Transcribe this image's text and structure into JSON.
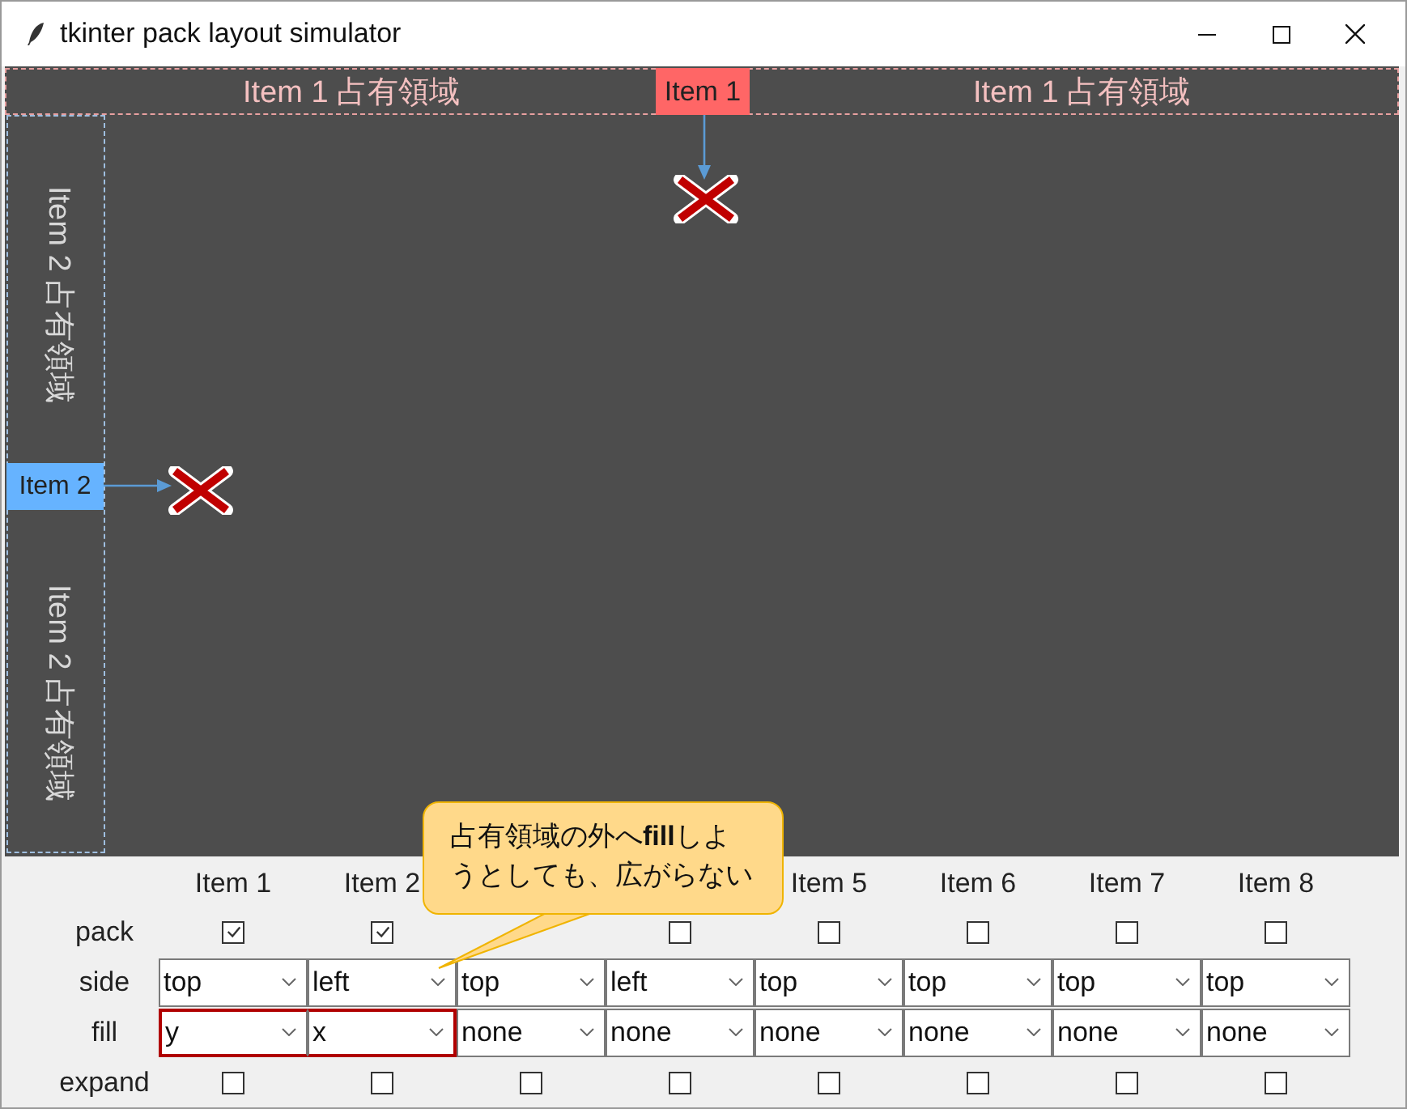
{
  "window": {
    "title": "tkinter pack layout simulator"
  },
  "canvas": {
    "items": [
      {
        "label": "Item 1",
        "kind": "horizontal",
        "color": "#ff6666",
        "region_labels": [
          "Item 1 占有領域",
          "Item 1 占有領域"
        ]
      },
      {
        "label": "Item 2",
        "kind": "vertical",
        "color": "#66b3ff",
        "region_labels": [
          "Item 2 占有領域",
          "Item 2 占有領域"
        ]
      }
    ]
  },
  "controls": {
    "row_labels": [
      "pack",
      "side",
      "fill",
      "expand"
    ],
    "columns": [
      {
        "header": "Item 1",
        "pack": {
          "checked": true
        },
        "side": "top",
        "fill": "y",
        "fill_highlighted": true,
        "expand": {
          "checked": false
        }
      },
      {
        "header": "Item 2",
        "pack": {
          "checked": true
        },
        "side": "left",
        "fill": "x",
        "fill_highlighted": true,
        "expand": {
          "checked": false
        }
      },
      {
        "side": "top",
        "fill": "none",
        "fill_highlighted": false,
        "expand": {
          "checked": false
        }
      },
      {
        "pack": {
          "checked": false
        },
        "side": "left",
        "fill": "none",
        "fill_highlighted": false,
        "expand": {
          "checked": false
        }
      },
      {
        "header": "Item 5",
        "pack": {
          "checked": false
        },
        "side": "top",
        "fill": "none",
        "fill_highlighted": false,
        "expand": {
          "checked": false
        }
      },
      {
        "header": "Item 6",
        "pack": {
          "checked": false
        },
        "side": "top",
        "fill": "none",
        "fill_highlighted": false,
        "expand": {
          "checked": false
        }
      },
      {
        "header": "Item 7",
        "pack": {
          "checked": false
        },
        "side": "top",
        "fill": "none",
        "fill_highlighted": false,
        "expand": {
          "checked": false
        }
      },
      {
        "header": "Item 8",
        "pack": {
          "checked": false
        },
        "side": "top",
        "fill": "none",
        "fill_highlighted": false,
        "expand": {
          "checked": false
        }
      }
    ]
  },
  "callout": {
    "text": "占有領域の外へ**fill**しようとしても、広がらない"
  }
}
